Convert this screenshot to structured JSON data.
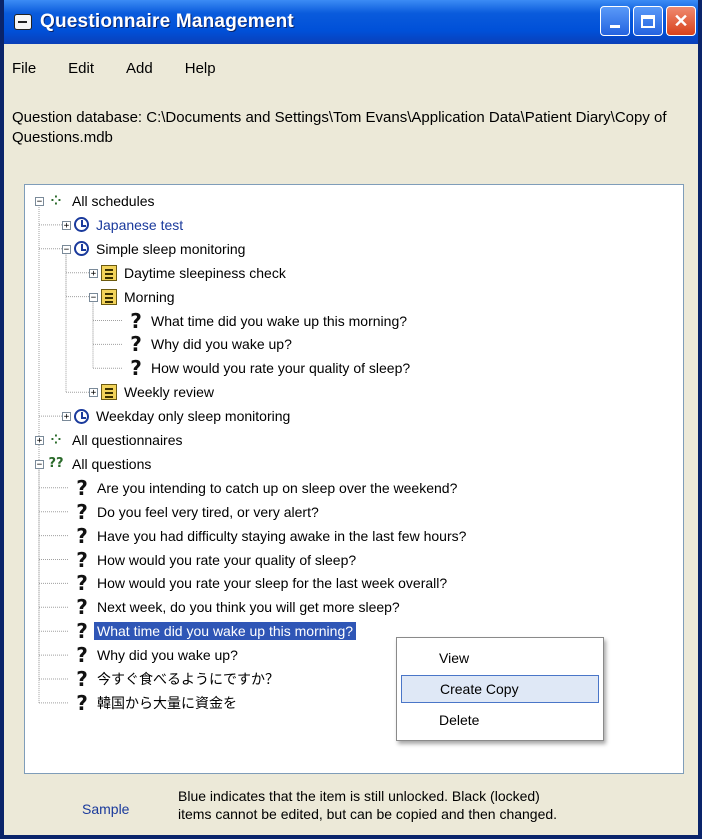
{
  "window": {
    "title": "Questionnaire Management"
  },
  "menu": [
    "File",
    "Edit",
    "Add",
    "Help"
  ],
  "database": {
    "path_text": "Question database: C:\\Documents and Settings\\Tom Evans\\Application Data\\Patient Diary\\Copy of Questions.mdb"
  },
  "tree": {
    "rows": [
      {
        "label": "All schedules",
        "icon": "schedules-group-icon",
        "expander": "-",
        "unlocked": false
      },
      {
        "label": "Japanese test",
        "icon": "clock-icon",
        "expander": "+",
        "unlocked": true
      },
      {
        "label": "Simple sleep monitoring",
        "icon": "clock-icon",
        "expander": "-",
        "unlocked": false
      },
      {
        "label": "Daytime sleepiness check",
        "icon": "questionnaire-icon",
        "expander": "+",
        "unlocked": false
      },
      {
        "label": "Morning",
        "icon": "questionnaire-icon",
        "expander": "-",
        "unlocked": false
      },
      {
        "label": "What time did you wake up this morning?",
        "icon": "question-icon",
        "expander": "",
        "unlocked": false
      },
      {
        "label": "Why did you wake up?",
        "icon": "question-icon",
        "expander": "",
        "unlocked": false
      },
      {
        "label": "How would you rate your quality of sleep?",
        "icon": "question-icon",
        "expander": "",
        "unlocked": false
      },
      {
        "label": "Weekly review",
        "icon": "questionnaire-icon",
        "expander": "+",
        "unlocked": false
      },
      {
        "label": "Weekday only sleep monitoring",
        "icon": "clock-icon",
        "expander": "+",
        "unlocked": false
      },
      {
        "label": "All questionnaires",
        "icon": "questionnaires-group-icon",
        "expander": "+",
        "unlocked": false
      },
      {
        "label": "All questions",
        "icon": "questions-group-icon",
        "expander": "-",
        "unlocked": false
      },
      {
        "label": "Are you intending to catch up on sleep over the weekend?",
        "icon": "question-icon",
        "expander": "",
        "unlocked": false
      },
      {
        "label": "Do you feel very tired, or very alert?",
        "icon": "question-icon",
        "expander": "",
        "unlocked": false
      },
      {
        "label": "Have you had difficulty staying awake in the last few hours?",
        "icon": "question-icon",
        "expander": "",
        "unlocked": false
      },
      {
        "label": "How would you rate your quality of sleep?",
        "icon": "question-icon",
        "expander": "",
        "unlocked": false
      },
      {
        "label": "How would you rate your sleep for the last week overall?",
        "icon": "question-icon",
        "expander": "",
        "unlocked": false
      },
      {
        "label": "Next week, do you think you will get more sleep?",
        "icon": "question-icon",
        "expander": "",
        "unlocked": false
      },
      {
        "label": "What time did you wake up this morning?",
        "icon": "question-icon",
        "expander": "",
        "unlocked": false,
        "selected": true
      },
      {
        "label": "Why did you wake up?",
        "icon": "question-icon",
        "expander": "",
        "unlocked": false
      },
      {
        "label": "今すぐ食べるようにですか？",
        "icon": "question-icon",
        "expander": "",
        "unlocked": false
      },
      {
        "label": "韓国から大量に資金を",
        "icon": "question-icon",
        "expander": "",
        "unlocked": false
      }
    ]
  },
  "context_menu": {
    "items": [
      "View",
      "Create Copy",
      "Delete"
    ],
    "highlighted": "Create Copy"
  },
  "footer": {
    "sample_label": "Sample",
    "note_line1": "Blue indicates that the item is still unlocked.  Black (locked)",
    "note_line2": "items cannot be edited, but can be copied and then changed."
  },
  "colors": {
    "unlocked_text": "#1a3a9c",
    "selection": "#2f56b6",
    "titlebar": "#0050d8",
    "window_bg": "#ece9d8"
  }
}
